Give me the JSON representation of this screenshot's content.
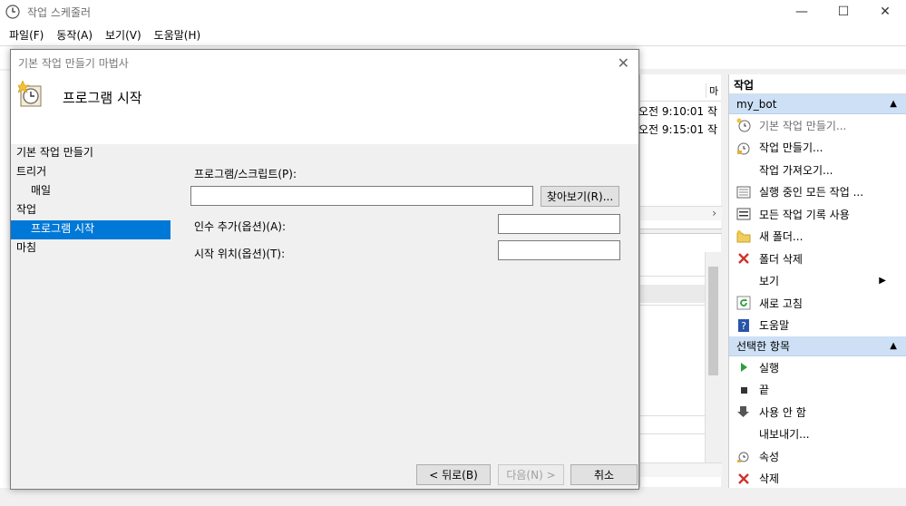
{
  "window": {
    "title": "작업 스케줄러"
  },
  "menu": [
    "파일(F)",
    "동작(A)",
    "보기(V)",
    "도움말(H)"
  ],
  "center": {
    "col_header": "마",
    "rows": [
      "오전 9:10:01  작",
      "오전 9:15:01  작"
    ]
  },
  "actions": {
    "pane_title": "작업",
    "section1": "my_bot",
    "items1": [
      {
        "label": "기본 작업 만들기...",
        "icon": "clock-star-icon"
      },
      {
        "label": "작업 만들기...",
        "icon": "clock-icon"
      },
      {
        "label": "작업 가져오기...",
        "icon": ""
      },
      {
        "label": "실행 중인 모든 작업 ...",
        "icon": "list-icon"
      },
      {
        "label": "모든 작업 기록 사용",
        "icon": "history-icon"
      },
      {
        "label": "새 폴더...",
        "icon": "folder-icon"
      },
      {
        "label": "폴더 삭제",
        "icon": "delete-x-icon"
      },
      {
        "label": "보기",
        "icon": ""
      },
      {
        "label": "새로 고침",
        "icon": "refresh-icon"
      },
      {
        "label": "도움말",
        "icon": "help-icon"
      }
    ],
    "section2": "선택한 항목",
    "items2": [
      {
        "label": "실행",
        "icon": "play-icon"
      },
      {
        "label": "끝",
        "icon": "stop-icon"
      },
      {
        "label": "사용 안 함",
        "icon": "down-arrow-icon"
      },
      {
        "label": "내보내기...",
        "icon": ""
      },
      {
        "label": "속성",
        "icon": "properties-icon"
      },
      {
        "label": "삭제",
        "icon": "delete-x-icon"
      }
    ]
  },
  "dialog": {
    "title": "기본 작업 만들기 마법사",
    "heading": "프로그램 시작",
    "steps": [
      "기본 작업 만들기",
      "트리거",
      "매일",
      "작업",
      "프로그램 시작",
      "마침"
    ],
    "program_label": "프로그램/스크립트(P):",
    "program_value": "",
    "browse": "찾아보기(R)...",
    "args_label": "인수 추가(옵션)(A):",
    "args_value": "",
    "startin_label": "시작 위치(옵션)(T):",
    "startin_value": "",
    "back": "< 뒤로(B)",
    "next": "다음(N) >",
    "cancel": "취소"
  }
}
